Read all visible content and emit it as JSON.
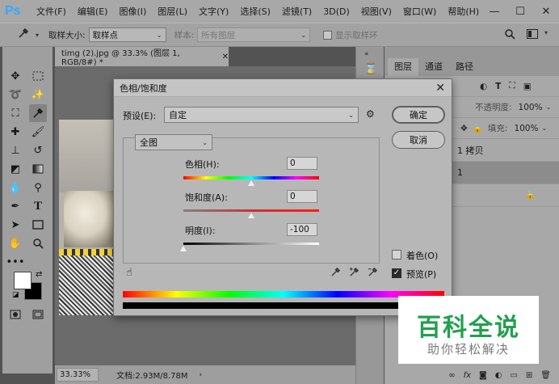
{
  "app": {
    "logo": "Ps"
  },
  "menu": [
    "文件(F)",
    "编辑(E)",
    "图像(I)",
    "图层(L)",
    "文字(Y)",
    "选择(S)",
    "滤镜(T)",
    "3D(D)",
    "视图(V)",
    "窗口(W)",
    "帮助(H)"
  ],
  "window_controls": {
    "minimize": "—",
    "restore": "☐",
    "close": "✕"
  },
  "options_bar": {
    "sample_size_label": "取样大小:",
    "sample_size_value": "取样点",
    "sample_label": "样本:",
    "sample_value": "所有图层",
    "show_ring_label": "显示取样环"
  },
  "document": {
    "tab_title": "timg (2).jpg @ 33.3% (图层 1, RGB/8#) *",
    "tab_close": "✕",
    "zoom": "33.33%",
    "doc_size": "文档:2.93M/8.78M",
    "status_arrow": "›"
  },
  "layers_panel": {
    "tabs": [
      "图层",
      "通道",
      "路径"
    ],
    "opacity_label": "不透明度:",
    "opacity_value": "100%",
    "fill_label": "填充:",
    "fill_value": "100%",
    "layers": [
      "1 拷贝",
      "1"
    ],
    "lock_icon": "🔒"
  },
  "dialog": {
    "title": "色相/饱和度",
    "close": "✕",
    "preset_label": "预设(E):",
    "preset_value": "自定",
    "channel_value": "全图",
    "hue_label": "色相(H):",
    "hue_value": "0",
    "saturation_label": "饱和度(A):",
    "saturation_value": "0",
    "lightness_label": "明度(I):",
    "lightness_value": "-100",
    "ok_label": "确定",
    "cancel_label": "取消",
    "colorize_label": "着色(O)",
    "colorize_checked": false,
    "preview_label": "预览(P)",
    "preview_checked": true
  },
  "watermark": {
    "title": "百科全说",
    "subtitle": "助你轻松解决"
  }
}
